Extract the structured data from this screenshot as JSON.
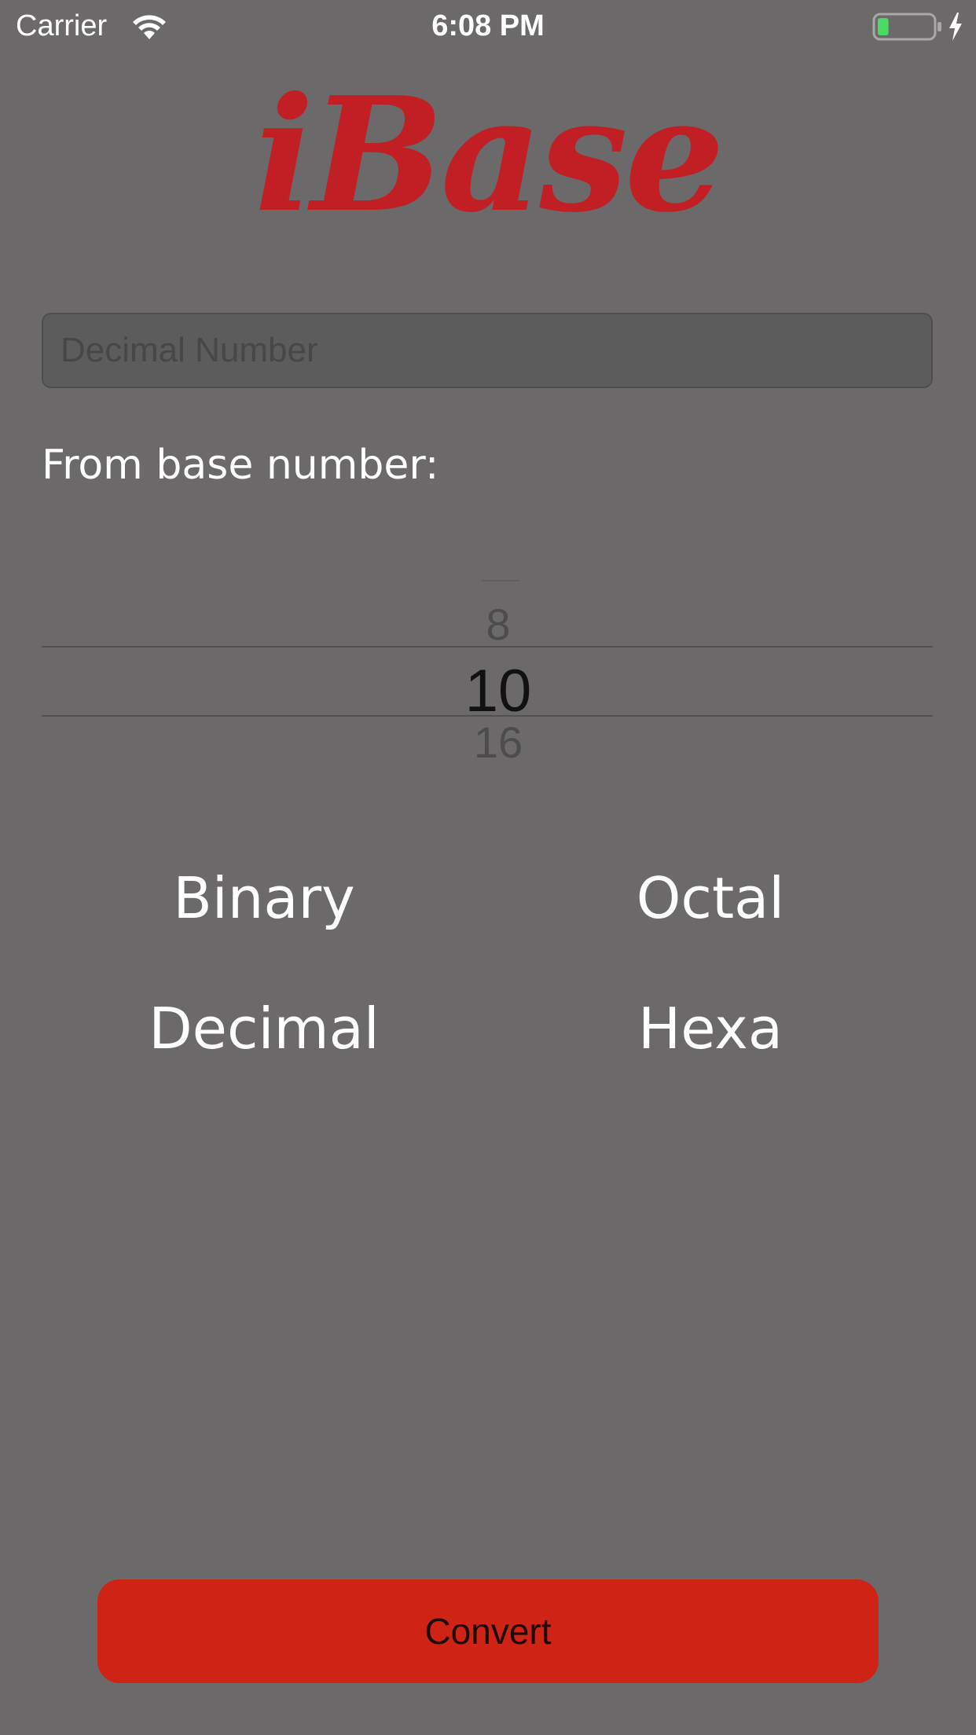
{
  "status_bar": {
    "carrier": "Carrier",
    "time": "6:08 PM",
    "battery_level": 0.2,
    "battery_color": "#4cd964",
    "charging": true
  },
  "app": {
    "logo_text": "iBase",
    "logo_color": "#c11f24",
    "background_color": "#6b696a"
  },
  "input": {
    "placeholder": "Decimal Number",
    "value": ""
  },
  "from_label": "From base number:",
  "picker": {
    "prev": "8",
    "selected": "10",
    "next": "16"
  },
  "results": {
    "binary": "Binary",
    "octal": "Octal",
    "decimal": "Decimal",
    "hexa": "Hexa"
  },
  "convert_button": {
    "label": "Convert",
    "color": "#cf2316"
  }
}
